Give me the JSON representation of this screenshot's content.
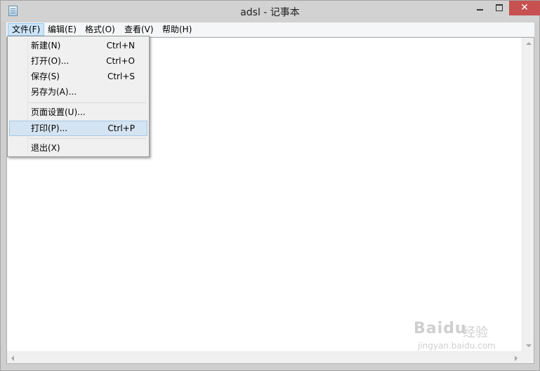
{
  "window": {
    "title": "adsl - 记事本",
    "close_glyph": "✕"
  },
  "menubar": [
    {
      "label": "文件(F)",
      "active": true
    },
    {
      "label": "编辑(E)"
    },
    {
      "label": "格式(O)"
    },
    {
      "label": "查看(V)"
    },
    {
      "label": "帮助(H)"
    }
  ],
  "file_menu": {
    "items": [
      {
        "label": "新建(N)",
        "shortcut": "Ctrl+N"
      },
      {
        "label": "打开(O)...",
        "shortcut": "Ctrl+O"
      },
      {
        "label": "保存(S)",
        "shortcut": "Ctrl+S"
      },
      {
        "label": "另存为(A)...",
        "shortcut": ""
      },
      {
        "label": "页面设置(U)...",
        "shortcut": ""
      },
      {
        "label": "打印(P)...",
        "shortcut": "Ctrl+P",
        "highlighted": true
      },
      {
        "label": "退出(X)",
        "shortcut": ""
      }
    ]
  },
  "editor": {
    "content": ""
  },
  "watermark": {
    "brand": "Baidu",
    "sub": "经验",
    "url": "jingyan.baidu.com"
  },
  "colors": {
    "menu_highlight": "#d5e4f2",
    "menubar_active": "#cce4f7",
    "close_button": "#c75050"
  }
}
